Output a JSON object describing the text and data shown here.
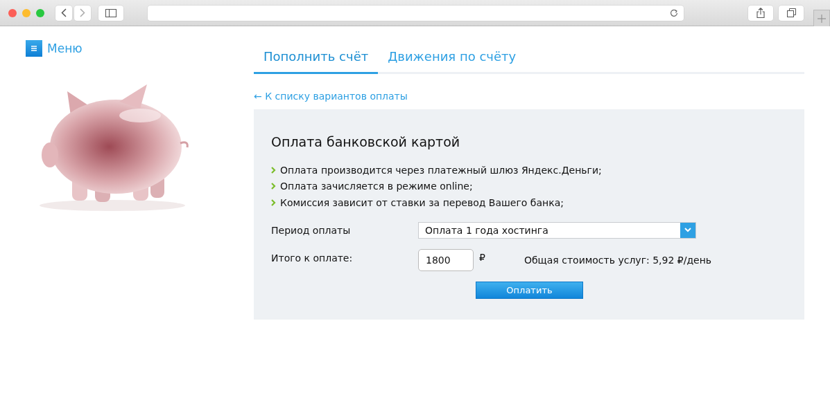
{
  "menu": {
    "label": "Меню"
  },
  "tabs": [
    {
      "label": "Пополнить счёт",
      "selected": true
    },
    {
      "label": "Движения по счёту",
      "selected": false
    }
  ],
  "back_link": "← К списку вариантов оплаты",
  "panel": {
    "title": "Оплата банковской картой",
    "bullets": [
      "Оплата производится через платежный шлюз Яндекс.Деньги;",
      "Оплата зачисляется в режиме online;",
      "Комиссия зависит от ставки за перевод Вашего банка;"
    ],
    "period": {
      "label": "Период оплаты",
      "value": "Оплата 1 года хостинга"
    },
    "total": {
      "label": "Итого к оплате:",
      "value": "1800",
      "currency": "₽",
      "note": "Общая стоимость услуг: 5,92 ₽/день"
    },
    "button": "Оплатить"
  }
}
